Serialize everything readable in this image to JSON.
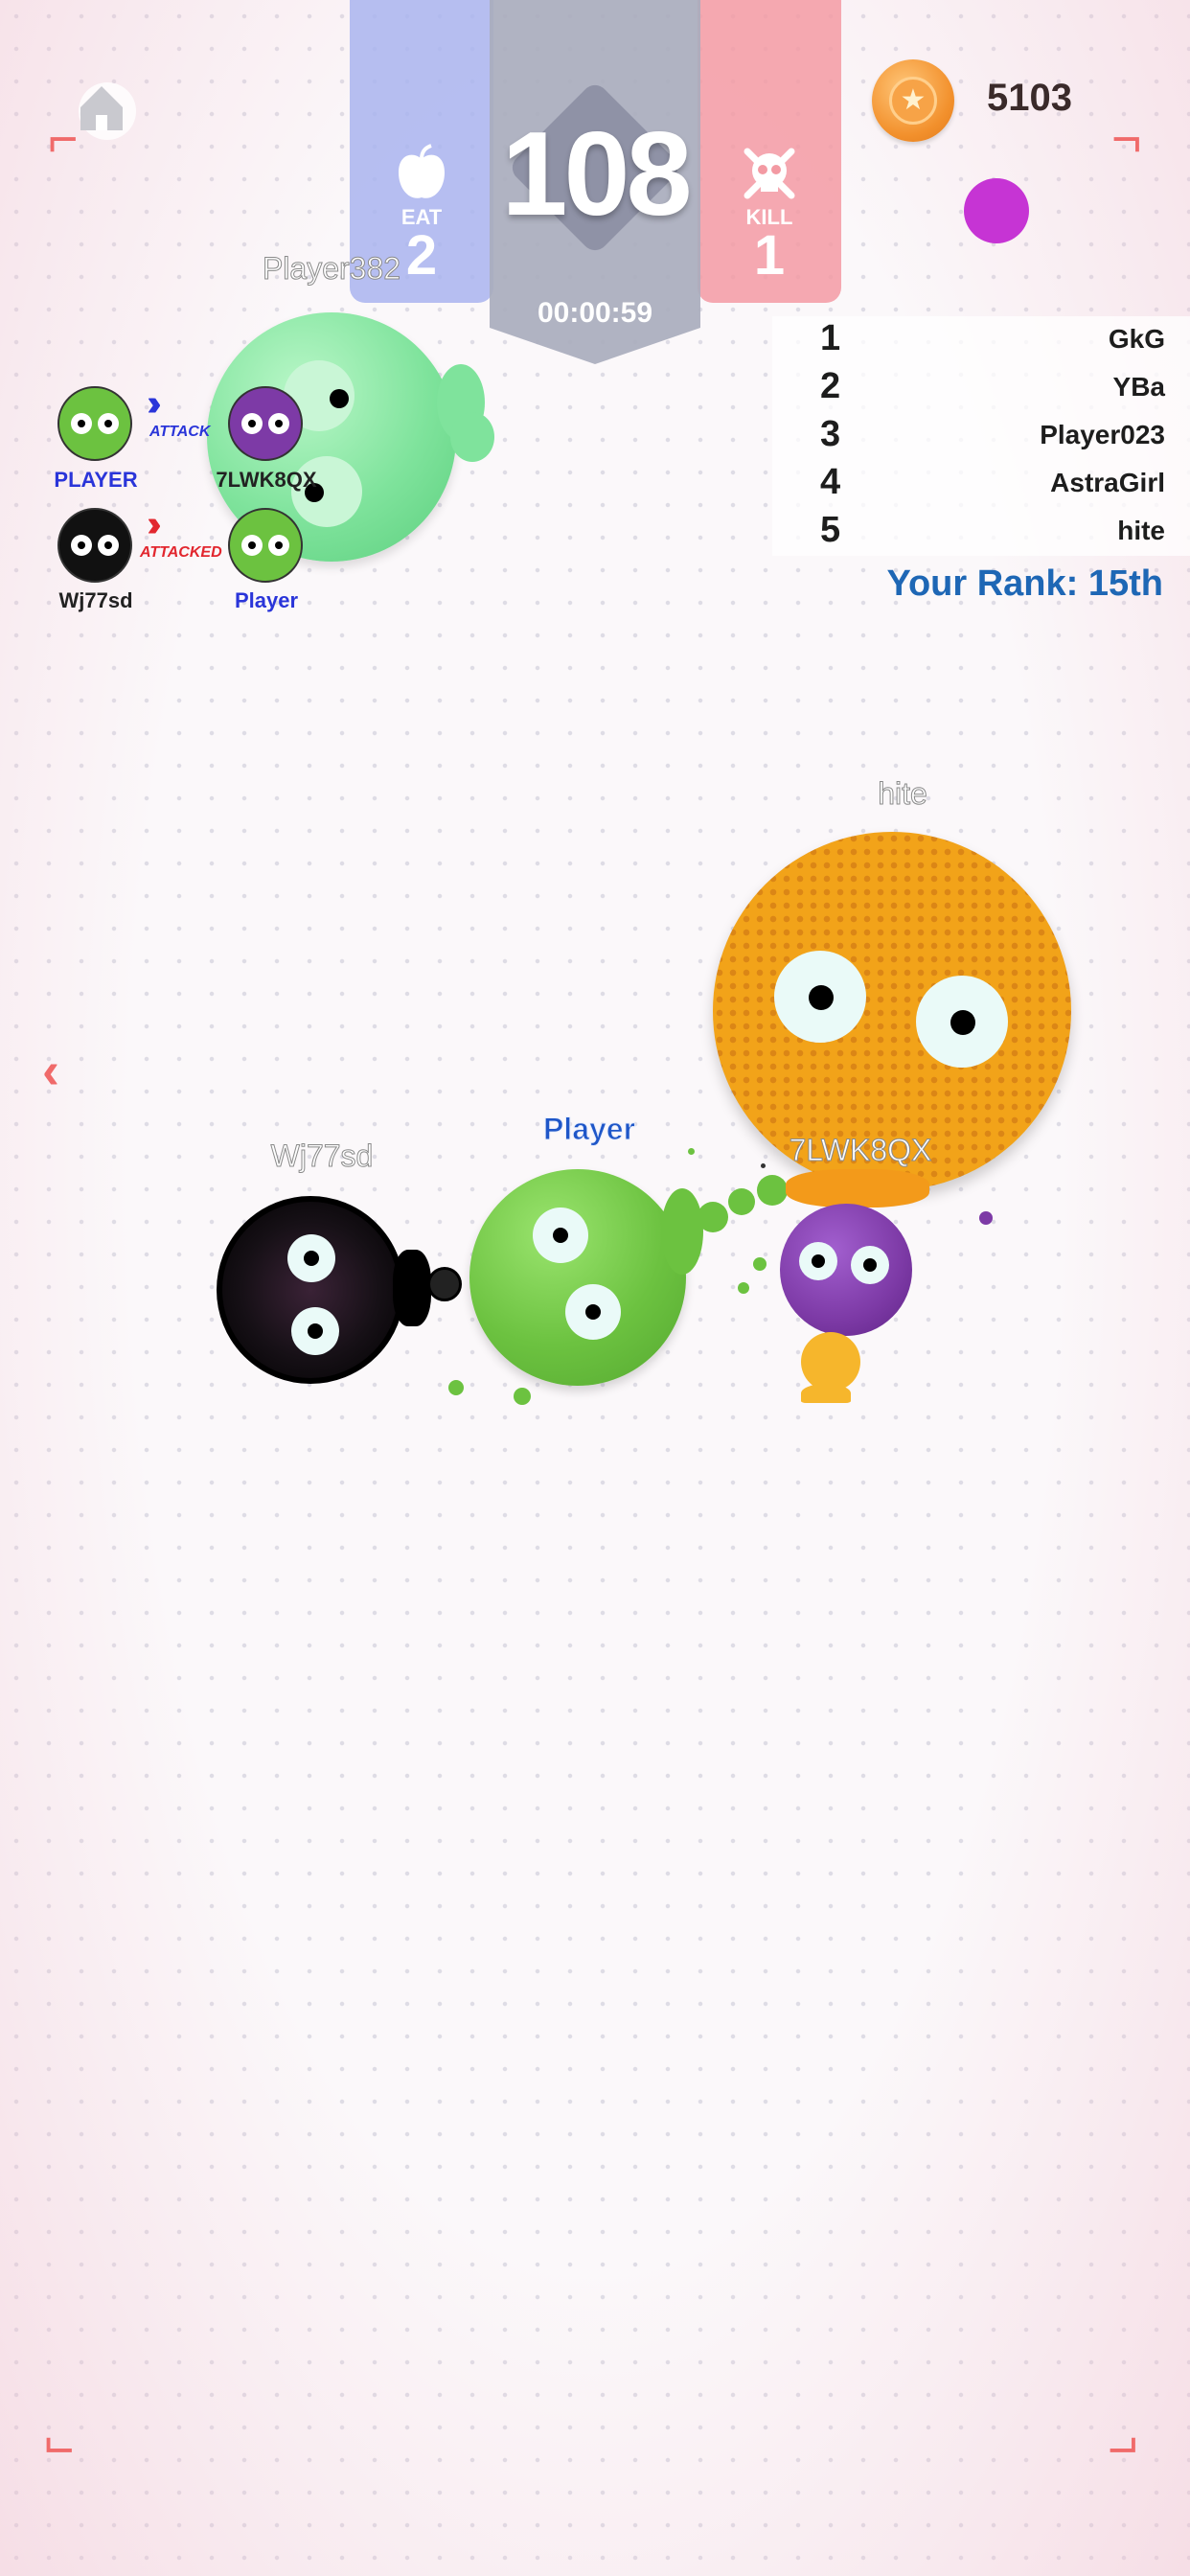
{
  "hud": {
    "score": "108",
    "timer": "00:00:59",
    "eat_label": "EAT",
    "eat_count": "2",
    "kill_label": "KILL",
    "kill_count": "1",
    "coins": "5103"
  },
  "leaderboard": {
    "rows": [
      {
        "rank": "1",
        "name": "GkG"
      },
      {
        "rank": "2",
        "name": "YBa"
      },
      {
        "rank": "3",
        "name": "Player023"
      },
      {
        "rank": "4",
        "name": "AstraGirl"
      },
      {
        "rank": "5",
        "name": "hite"
      }
    ],
    "your_rank": "Your Rank: 15th"
  },
  "kill_feed": [
    {
      "attacker": "PLAYER",
      "action": "ATTACK",
      "victim": "7LWK8QX"
    },
    {
      "attacker": "Wj77sd",
      "action": "ATTACKED",
      "victim": "Player"
    }
  ],
  "blobs": {
    "player382": "Player382",
    "hite": "hite",
    "player": "Player",
    "wj77sd": "Wj77sd",
    "lwk": "7LWK8QX"
  },
  "colors": {
    "player_green": "#6cc240",
    "player382_green": "#7fe39c",
    "hite_orange": "#f2a319",
    "lwk_purple": "#7d3aa6",
    "rank_blue": "#1e67b5",
    "attack_blue": "#2a35d9",
    "attacked_red": "#e2262e"
  },
  "icons": {
    "home": "home-icon",
    "eat": "apple-icon",
    "kill": "skull-icon",
    "coin": "star-coin-icon"
  }
}
